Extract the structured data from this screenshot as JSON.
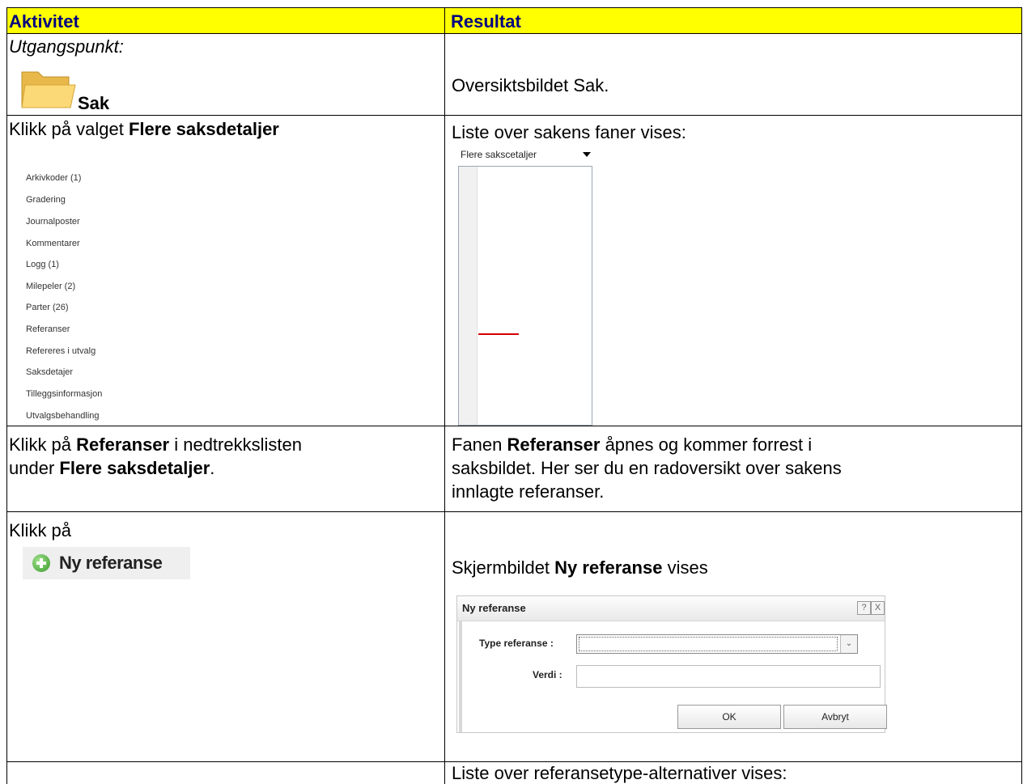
{
  "table": {
    "headers": [
      "Aktivitet",
      "Resultat"
    ]
  },
  "rows": [
    {
      "activity_label": "Utgangspunkt:",
      "activity_name": "Sak",
      "result": "Oversiktsbildet Sak."
    },
    {
      "activity_prefix": "Klikk på valget ",
      "activity_bold": "Flere saksdetaljer",
      "result": "Liste over sakens faner vises:"
    },
    {
      "activity_line1_prefix": "Klikk på ",
      "activity_line1_bold": "Referanser",
      "activity_line1_suffix": " i nedtrekkslisten",
      "activity_line2_prefix": "under ",
      "activity_line2_bold": "Flere saksdetaljer",
      "activity_line2_suffix": ".",
      "result_line1_prefix": "Fanen ",
      "result_line1_bold": "Referanser",
      "result_line1_suffix": " åpnes og kommer forrest i",
      "result_line2": "saksbildet. Her ser du en radoversikt over sakens",
      "result_line3": "innlagte referanser."
    },
    {
      "activity": "Klikk på",
      "result_prefix": "Skjermbildet ",
      "result_bold": "Ny referanse",
      "result_suffix": " vises"
    },
    {
      "result": "Liste over referansetype-alternativer vises:"
    }
  ],
  "dropdown": {
    "selected": "Flere sakscetaljer",
    "items": [
      "Arkivkoder (1)",
      "Gradering",
      "Journalposter",
      "Kommentarer",
      "Logg (1)",
      "Milepeler (2)",
      "Parter (26)",
      "Referanser",
      "Refereres i utvalg",
      "Saksdetajer",
      "Tilleggsinformasjon",
      "Utvalgsbehandling"
    ]
  },
  "ny_referanse_button": {
    "label": "Ny referanse",
    "icon": "plus-circle-icon"
  },
  "dialog": {
    "title": "Ny referanse",
    "help_glyph": "?",
    "close_glyph": "X",
    "type_label": "Type referanse :",
    "value_label": "Verdi :",
    "ok": "OK",
    "cancel": "Avbryt"
  },
  "colors": {
    "header_background": "#ffff00",
    "header_text": "#000080",
    "underline": "#d40000"
  }
}
